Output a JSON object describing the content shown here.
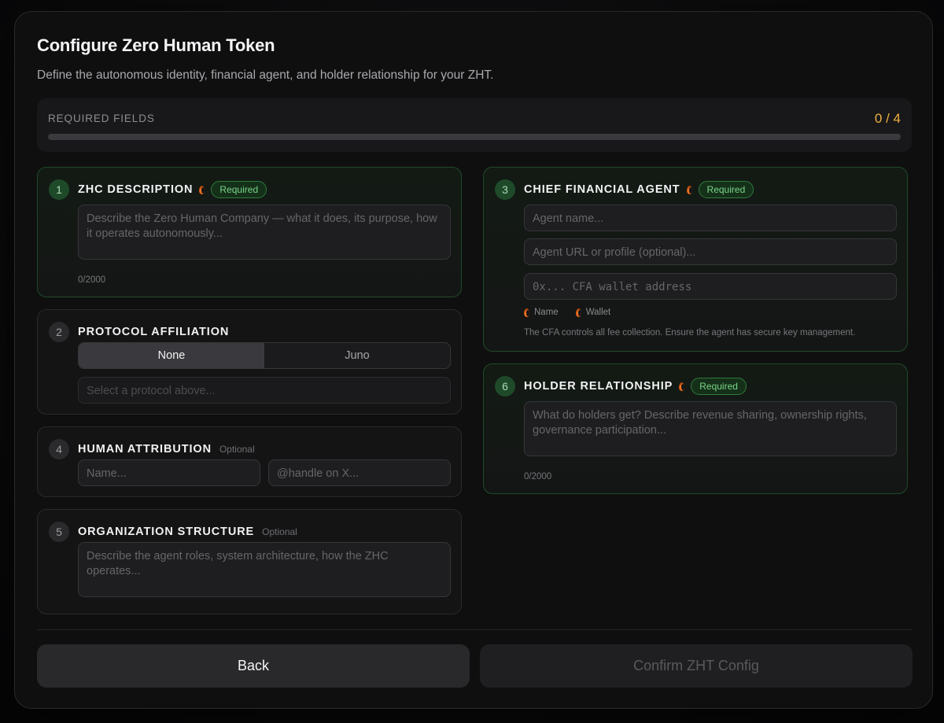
{
  "header": {
    "title": "Configure Zero Human Token",
    "subtitle": "Define the autonomous identity, financial agent, and holder relationship for your ZHT."
  },
  "progress": {
    "label": "REQUIRED FIELDS",
    "count": "0 / 4",
    "fraction": 0
  },
  "sections": {
    "zhc_description": {
      "number": "1",
      "title": "ZHC DESCRIPTION",
      "badge": "Required",
      "placeholder": "Describe the Zero Human Company — what it does, its purpose, how it operates autonomously...",
      "counter": "0/2000"
    },
    "protocol_affiliation": {
      "number": "2",
      "title": "PROTOCOL AFFILIATION",
      "options": [
        "None",
        "Juno"
      ],
      "selected": "None",
      "placeholder": "Select a protocol above..."
    },
    "chief_financial_agent": {
      "number": "3",
      "title": "CHIEF FINANCIAL AGENT",
      "badge": "Required",
      "name_placeholder": "Agent name...",
      "url_placeholder": "Agent URL or profile (optional)...",
      "wallet_placeholder": "0x... CFA wallet address",
      "legend_name": "Name",
      "legend_wallet": "Wallet",
      "note": "The CFA controls all fee collection. Ensure the agent has secure key management."
    },
    "human_attribution": {
      "number": "4",
      "title": "HUMAN ATTRIBUTION",
      "optional": "Optional",
      "name_placeholder": "Name...",
      "handle_placeholder": "@handle on X..."
    },
    "organization_structure": {
      "number": "5",
      "title": "ORGANIZATION STRUCTURE",
      "optional": "Optional",
      "placeholder": "Describe the agent roles, system architecture, how the ZHC operates..."
    },
    "holder_relationship": {
      "number": "6",
      "title": "HOLDER RELATIONSHIP",
      "badge": "Required",
      "placeholder": "What do holders get? Describe revenue sharing, ownership rights, governance participation...",
      "counter": "0/2000"
    }
  },
  "footer": {
    "back_label": "Back",
    "confirm_label": "Confirm ZHT Config"
  },
  "colors": {
    "accent_amber": "#f0b040",
    "required_green": "#79d58a",
    "background": "#0f0f10"
  }
}
